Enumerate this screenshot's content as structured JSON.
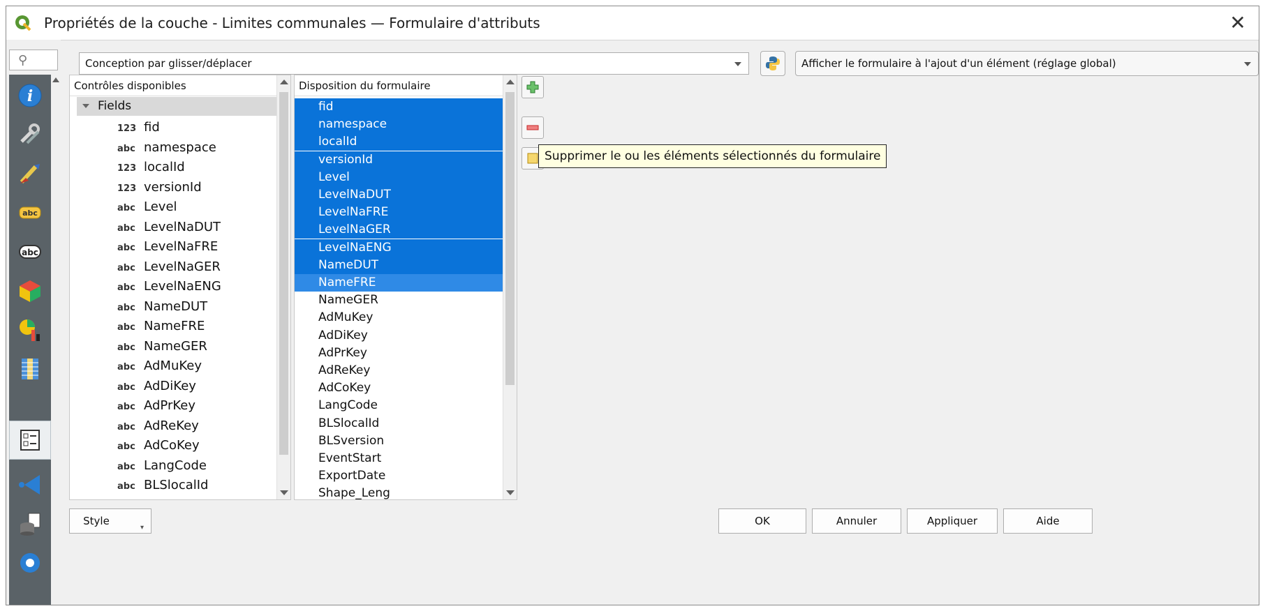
{
  "window": {
    "title": "Propriétés de la couche - Limites communales — Formulaire d'attributs",
    "close_label": "✕"
  },
  "toolbar": {
    "mode_value": "Conception par glisser/déplacer",
    "suppress_value": "Afficher le formulaire à l'ajout d'un élément (réglage global)"
  },
  "sidebar": {
    "icons": [
      "info-icon",
      "source-icon",
      "symbology-icon",
      "labels-icon",
      "masks-icon",
      "3d-view-icon",
      "diagrams-icon",
      "fields-icon",
      "attributes-form-icon",
      "joins-icon",
      "storage-icon",
      "actions-icon"
    ]
  },
  "available": {
    "header": "Contrôles disponibles",
    "root_label": "Fields",
    "fields": [
      {
        "type": "123",
        "name": "fid"
      },
      {
        "type": "abc",
        "name": "namespace"
      },
      {
        "type": "123",
        "name": "localId"
      },
      {
        "type": "123",
        "name": "versionId"
      },
      {
        "type": "abc",
        "name": "Level"
      },
      {
        "type": "abc",
        "name": "LevelNaDUT"
      },
      {
        "type": "abc",
        "name": "LevelNaFRE"
      },
      {
        "type": "abc",
        "name": "LevelNaGER"
      },
      {
        "type": "abc",
        "name": "LevelNaENG"
      },
      {
        "type": "abc",
        "name": "NameDUT"
      },
      {
        "type": "abc",
        "name": "NameFRE"
      },
      {
        "type": "abc",
        "name": "NameGER"
      },
      {
        "type": "abc",
        "name": "AdMuKey"
      },
      {
        "type": "abc",
        "name": "AdDiKey"
      },
      {
        "type": "abc",
        "name": "AdPrKey"
      },
      {
        "type": "abc",
        "name": "AdReKey"
      },
      {
        "type": "abc",
        "name": "AdCoKey"
      },
      {
        "type": "abc",
        "name": "LangCode"
      },
      {
        "type": "abc",
        "name": "BLSlocalId"
      }
    ]
  },
  "layout": {
    "header": "Disposition du formulaire",
    "items": [
      {
        "name": "fid",
        "selected": true
      },
      {
        "name": "namespace",
        "selected": true
      },
      {
        "name": "localId",
        "selected": true
      },
      {
        "name": "versionId",
        "selected": true
      },
      {
        "name": "Level",
        "selected": true
      },
      {
        "name": "LevelNaDUT",
        "selected": true
      },
      {
        "name": "LevelNaFRE",
        "selected": true
      },
      {
        "name": "LevelNaGER",
        "selected": true
      },
      {
        "name": "LevelNaENG",
        "selected": true
      },
      {
        "name": "NameDUT",
        "selected": true
      },
      {
        "name": "NameFRE",
        "selected": true,
        "current": true
      },
      {
        "name": "NameGER",
        "selected": false
      },
      {
        "name": "AdMuKey",
        "selected": false
      },
      {
        "name": "AdDiKey",
        "selected": false
      },
      {
        "name": "AdPrKey",
        "selected": false
      },
      {
        "name": "AdReKey",
        "selected": false
      },
      {
        "name": "AdCoKey",
        "selected": false
      },
      {
        "name": "LangCode",
        "selected": false
      },
      {
        "name": "BLSlocalId",
        "selected": false
      },
      {
        "name": "BLSversion",
        "selected": false
      },
      {
        "name": "EventStart",
        "selected": false
      },
      {
        "name": "ExportDate",
        "selected": false
      },
      {
        "name": "Shape_Leng",
        "selected": false
      }
    ]
  },
  "tooltip": "Supprimer le ou les éléments sélectionnés du formulaire",
  "buttons": {
    "style": "Style",
    "ok": "OK",
    "cancel": "Annuler",
    "apply": "Appliquer",
    "help": "Aide"
  },
  "colors": {
    "selection": "#0a73d9",
    "sidebar_bg": "#5a6267"
  }
}
